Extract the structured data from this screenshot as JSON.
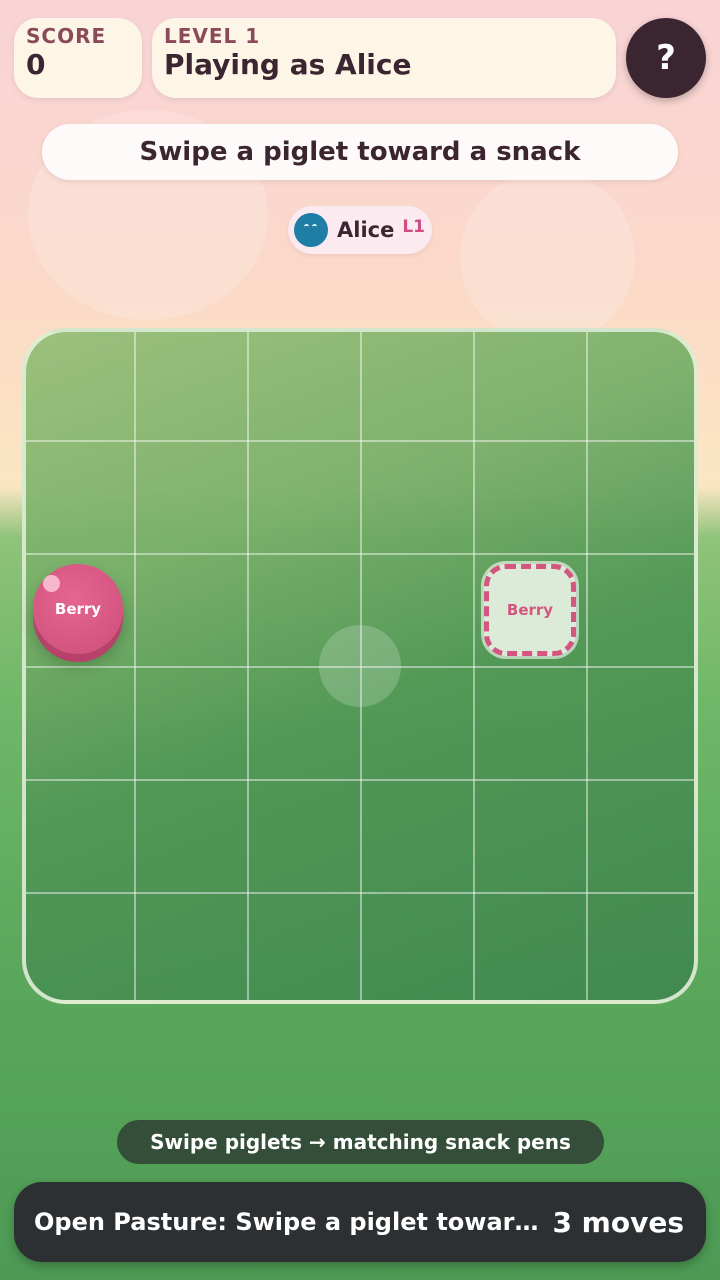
{
  "hud": {
    "score_label": "SCORE",
    "score_value": "0",
    "level_label": "LEVEL 1",
    "player_text": "Playing as Alice",
    "help_label": "?"
  },
  "instruction": "Swipe a piglet toward a snack",
  "player_chip": {
    "name": "Alice",
    "level": "L1",
    "avatar_icon": "blue-piglet-avatar"
  },
  "board": {
    "rows": 6,
    "cols": 6,
    "piglet": {
      "label": "Berry",
      "row": 3,
      "col": 1,
      "color": "#d45580"
    },
    "pen": {
      "label": "Berry",
      "row": 3,
      "col": 5,
      "color": "#d45580"
    }
  },
  "hint": "Swipe piglets → matching snack pens",
  "status": {
    "text": "Open Pasture: Swipe a piglet toward a snack",
    "moves": "3 moves"
  },
  "colors": {
    "accent": "#d45580",
    "dark": "#3b2530",
    "panel": "#fdf6e7"
  }
}
